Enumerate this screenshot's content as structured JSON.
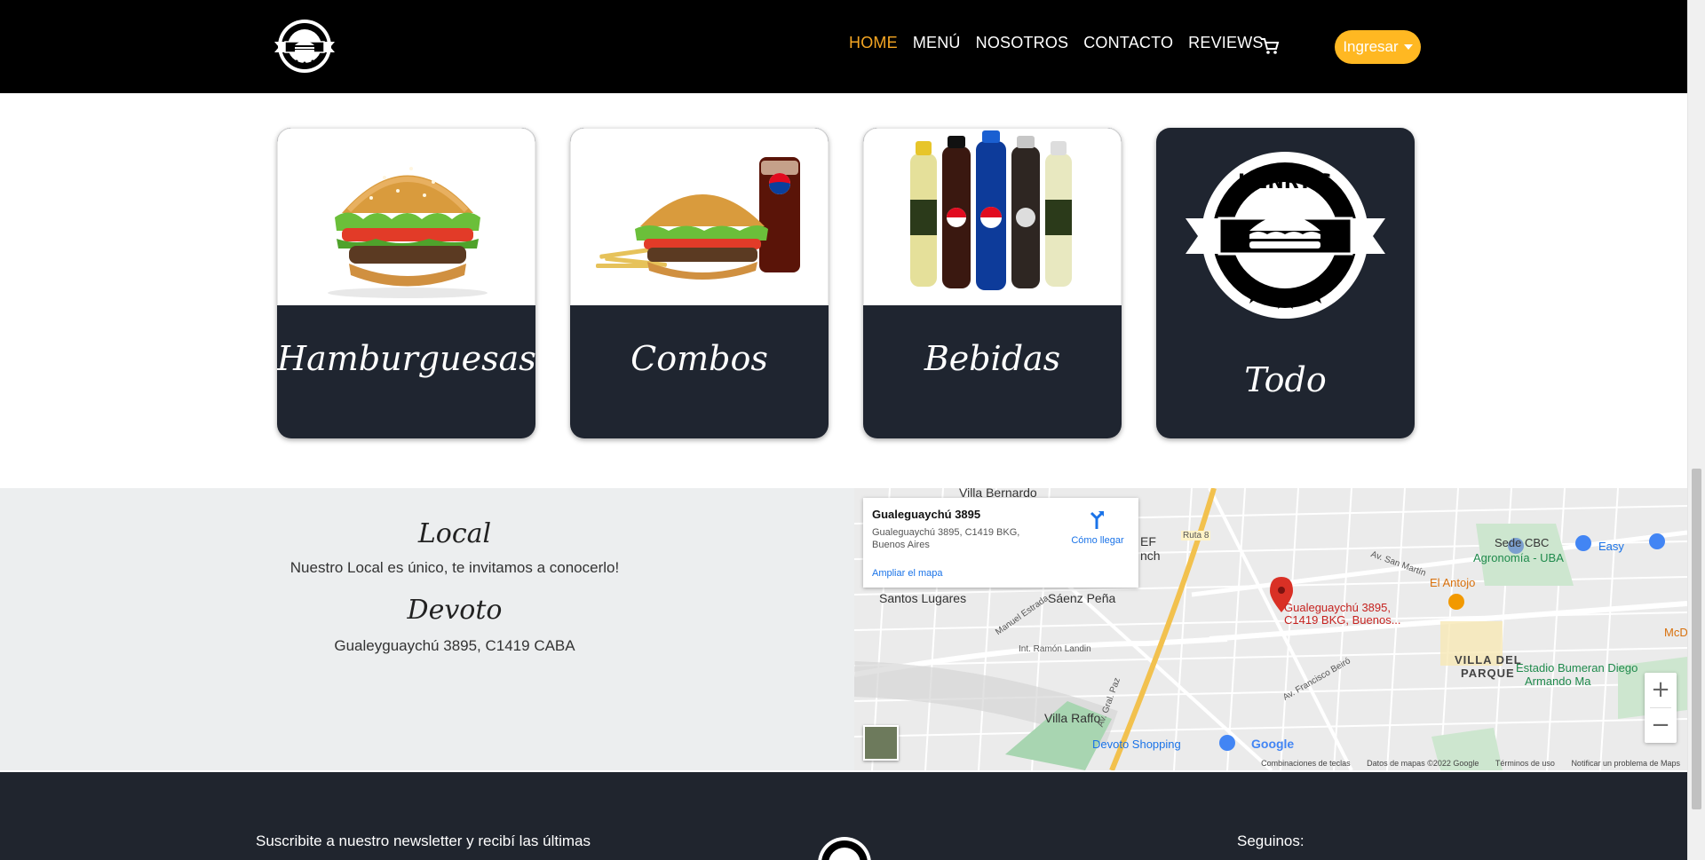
{
  "nav": {
    "links": [
      {
        "label": "HOME"
      },
      {
        "label": "MENÚ"
      },
      {
        "label": "NOSOTROS"
      },
      {
        "label": "CONTACTO"
      },
      {
        "label": "REVIEWS"
      }
    ],
    "login_label": "Ingresar",
    "logo_text": "HENRY'S"
  },
  "categories": [
    {
      "label": "Hamburguesas"
    },
    {
      "label": "Combos"
    },
    {
      "label": "Bebidas"
    },
    {
      "label": "Todo"
    }
  ],
  "location": {
    "title": "Local",
    "description": "Nuestro Local es único, te invitamos a conocerlo!",
    "branch_title": "Devoto",
    "address": "Gualeyguaychú 3895, C1419 CABA"
  },
  "map": {
    "card_name": "Gualeguaychú 3895",
    "card_address": "Gualeguaychú 3895, C1419 BKG, Buenos Aires",
    "directions_label": "Cómo llegar",
    "enlarge_label": "Ampliar el mapa",
    "labels": {
      "villa_bernardo": "Villa Bernardo",
      "santos_lugares": "Santos Lugares",
      "saenz_pena": "Sáenz Peña",
      "villa_raffo": "Villa Raffo",
      "devoto_shopping": "Devoto Shopping",
      "villa_del_parque_1": "VILLA DEL",
      "villa_del_parque_2": "PARQUE",
      "agronomia": "Agronomía - UBA",
      "sede_cbc": "Sede CBC",
      "el_antojo": "El Antojo",
      "easy": "Easy",
      "estadio_1": "Estadio Bumeran Diego",
      "estadio_2": "Armando Ma",
      "pin_1": "Gualeguaychú 3895,",
      "pin_2": "C1419 BKG, Buenos...",
      "ruta8": "Ruta 8",
      "av_gral_paz": "Av. Gral. Paz",
      "int_ramon_landin": "Int. Ramón Landin",
      "manuel_estrada": "Manuel Estrada",
      "av_san_martin": "Av. San Martín",
      "av_francisco_beiro": "Av. Francisco Beiró",
      "mcd": "McD",
      "ef": "EF",
      "nch": "nch"
    },
    "footer": {
      "shortcuts": "Combinaciones de teclas",
      "data": "Datos de mapas ©2022 Google",
      "terms": "Términos de uso",
      "report": "Notificar un problema de Maps"
    },
    "google_logo": "Google"
  },
  "footer": {
    "newsletter_text": "Suscribite a nuestro newsletter y recibí las últimas",
    "follow_label": "Seguinos:"
  },
  "colors": {
    "nav_bg": "#000000",
    "accent": "#f5a623",
    "login_bg": "#ffb822",
    "card_bg": "#1f2530",
    "location_bg": "#eceeef",
    "footer_bg": "#20252e"
  }
}
